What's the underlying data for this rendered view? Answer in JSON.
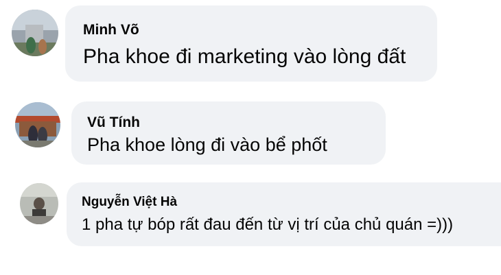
{
  "comments": [
    {
      "author": "Minh Võ",
      "text": "Pha khoe đi marketing vào lòng đất",
      "avatar_icon": "user-avatar-photo"
    },
    {
      "author": "Vũ Tính",
      "text": "Pha khoe lòng đi vào bể phốt",
      "avatar_icon": "user-avatar-photo"
    },
    {
      "author": "Nguyễn Việt Hà",
      "text": "1 pha tự bóp rất đau đến từ vị trí của chủ quán =)))",
      "avatar_icon": "user-avatar-photo"
    }
  ],
  "colors": {
    "bubble": "#f0f2f5",
    "text": "#050505",
    "background": "#ffffff"
  }
}
